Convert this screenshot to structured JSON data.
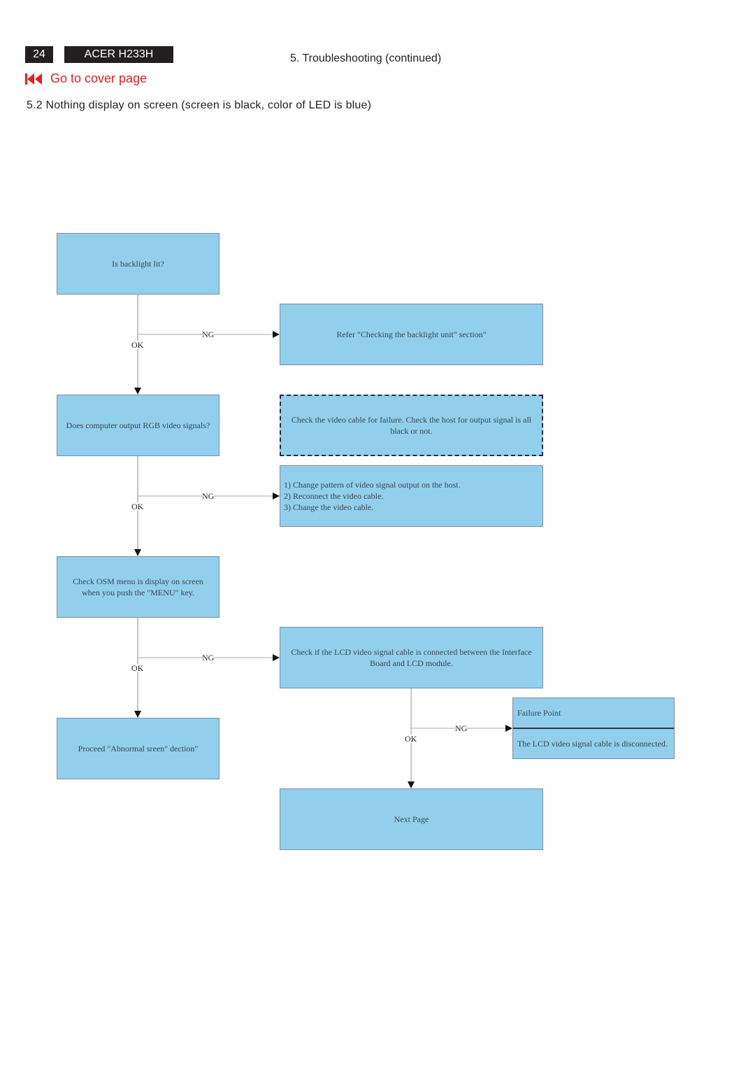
{
  "header": {
    "page_number": "24",
    "model": "ACER H233H",
    "section": "5. Troubleshooting (continued)",
    "cover_link": "Go to cover page",
    "cover_icon": "skip-to-start-icon",
    "subtitle": "5.2 Nothing display on screen (screen is black, color of LED is blue)"
  },
  "colors": {
    "box_fill": "#92cfec",
    "link_red": "#e31e24",
    "header_bg": "#231f20"
  },
  "flowchart": {
    "nodes": {
      "backlight": "Is backlight lit?",
      "refer_backlight": "Refer \"Checking the backlight unit\" section\"",
      "rgb": "Does computer output RGB video signals?",
      "check_cable": "Check the video cable for failure. Check the host for output signal is all black or not.",
      "actions": [
        "1) Change pattern of video signal output on the host.",
        "2) Reconnect the video cable.",
        "3) Change the video cable."
      ],
      "osm": "Check OSM menu is display on screen when you push the \"MENU\" key.",
      "proceed": "Proceed \"Abnormal sreen\" dection\"",
      "lcd_cable": "Check if the LCD video signal cable is connected between the Interface Board and LCD module.",
      "failure_title": "Failure Point",
      "failure_text": "The LCD video signal cable is disconnected.",
      "next_page": "Next Page"
    },
    "labels": {
      "ok": "OK",
      "ng": "NG"
    }
  }
}
